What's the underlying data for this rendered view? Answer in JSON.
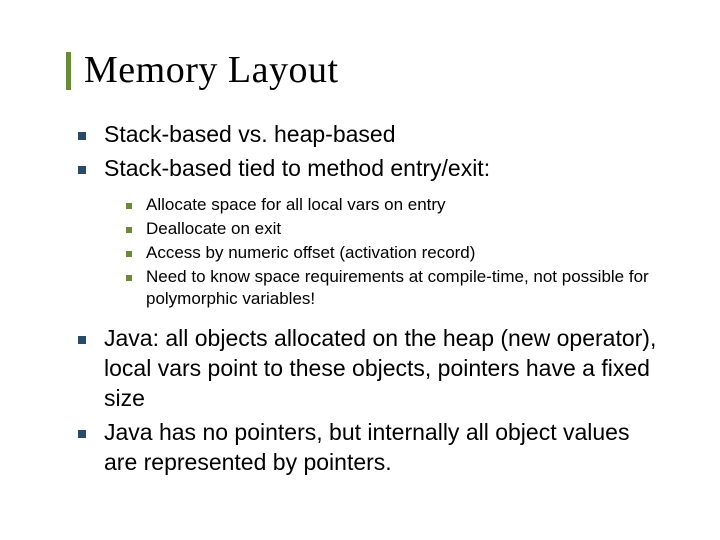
{
  "title": "Memory Layout",
  "bullets": {
    "b1": "Stack-based vs. heap-based",
    "b2": "Stack-based tied to method entry/exit:",
    "sub": {
      "s1": "Allocate space for all local vars on entry",
      "s2": "Deallocate on exit",
      "s3": "Access by numeric offset (activation record)",
      "s4": "Need to know space requirements at compile-time, not possible for polymorphic variables!"
    },
    "b3": "Java: all objects allocated on the heap (new operator), local vars point to these objects, pointers have a fixed size",
    "b4": "Java has no pointers, but internally all object values are represented by pointers."
  }
}
